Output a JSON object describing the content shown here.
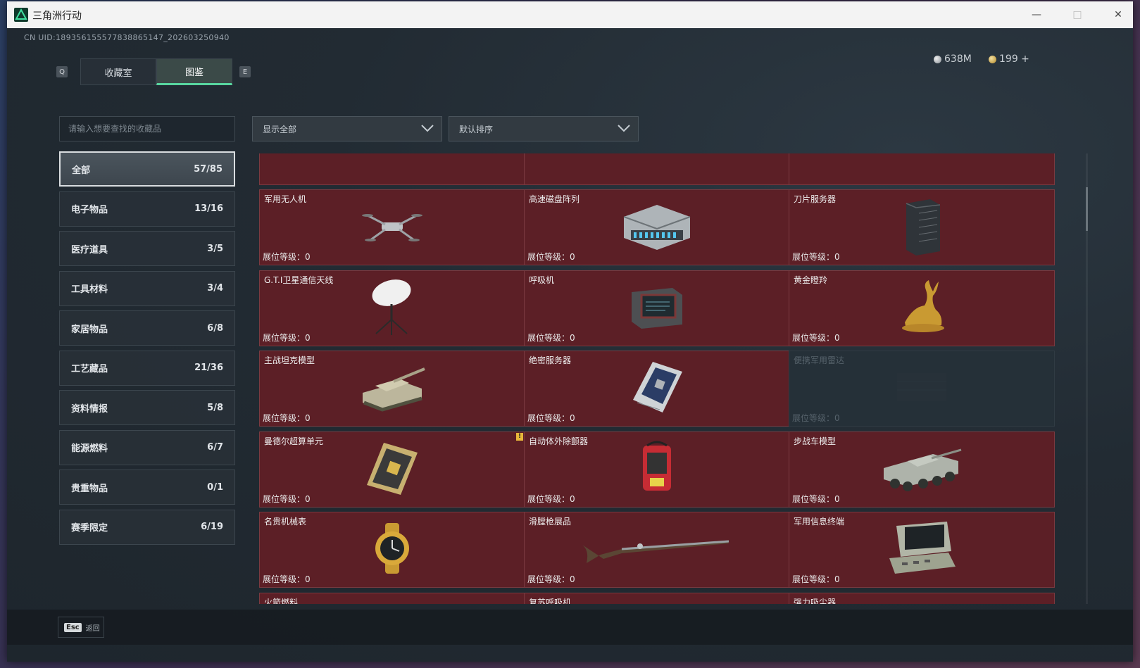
{
  "window": {
    "title": "三角洲行动",
    "minimize": "—",
    "maximize": "□",
    "close": "✕"
  },
  "header": {
    "uid": "CN UID:189356155577838865147_202603250940",
    "left_key": "Q",
    "right_key": "E",
    "tabs": [
      {
        "label": "收藏室",
        "active": false
      },
      {
        "label": "图鉴",
        "active": true
      }
    ],
    "currency": [
      {
        "icon": "silver-coin-icon",
        "value": "638M"
      },
      {
        "icon": "gold-coin-icon",
        "value": "199 +"
      }
    ]
  },
  "search": {
    "placeholder": "请输入想要查找的收藏品"
  },
  "filters": {
    "show": "显示全部",
    "sort": "默认排序"
  },
  "categories": [
    {
      "label": "全部",
      "count": "57/85",
      "active": true
    },
    {
      "label": "电子物品",
      "count": "13/16"
    },
    {
      "label": "医疗道具",
      "count": "3/5"
    },
    {
      "label": "工具材料",
      "count": "3/4"
    },
    {
      "label": "家居物品",
      "count": "6/8"
    },
    {
      "label": "工艺藏品",
      "count": "21/36"
    },
    {
      "label": "资料情报",
      "count": "5/8"
    },
    {
      "label": "能源燃料",
      "count": "6/7"
    },
    {
      "label": "贵重物品",
      "count": "0/1"
    },
    {
      "label": "赛季限定",
      "count": "6/19"
    }
  ],
  "items": [
    {
      "name": "军用无人机",
      "level": "展位等级：0",
      "icon": "drone-icon",
      "locked": false
    },
    {
      "name": "高速磁盘阵列",
      "level": "展位等级：0",
      "icon": "disk-array-icon",
      "locked": false
    },
    {
      "name": "刀片服务器",
      "level": "展位等级：0",
      "icon": "blade-server-icon",
      "locked": false
    },
    {
      "name": "G.T.I卫星通信天线",
      "level": "展位等级：0",
      "icon": "satellite-dish-icon",
      "locked": false
    },
    {
      "name": "呼吸机",
      "level": "展位等级：0",
      "icon": "ventilator-icon",
      "locked": false
    },
    {
      "name": "黄金瞪羚",
      "level": "展位等级：0",
      "icon": "gold-gazelle-icon",
      "locked": false
    },
    {
      "name": "主战坦克模型",
      "level": "展位等级：0",
      "icon": "tank-model-icon",
      "locked": false
    },
    {
      "name": "绝密服务器",
      "level": "展位等级：0",
      "icon": "secret-server-icon",
      "locked": false
    },
    {
      "name": "便携军用雷达",
      "level": "展位等级：0",
      "icon": "portable-radar-icon",
      "locked": true
    },
    {
      "name": "曼德尔超算单元",
      "level": "展位等级：0",
      "icon": "supercomputer-unit-icon",
      "locked": false,
      "badge": "!"
    },
    {
      "name": "自动体外除颤器",
      "level": "展位等级：0",
      "icon": "defibrillator-icon",
      "locked": false
    },
    {
      "name": "步战车模型",
      "level": "展位等级：0",
      "icon": "ifv-model-icon",
      "locked": false
    },
    {
      "name": "名贵机械表",
      "level": "展位等级：0",
      "icon": "watch-icon",
      "locked": false
    },
    {
      "name": "滑膛枪展品",
      "level": "展位等级：0",
      "icon": "musket-icon",
      "locked": false
    },
    {
      "name": "军用信息终端",
      "level": "展位等级：0",
      "icon": "military-terminal-icon",
      "locked": false
    },
    {
      "name": "火箭燃料",
      "level": "",
      "icon": "rocket-fuel-icon",
      "locked": false
    },
    {
      "name": "复苏呼吸机",
      "level": "",
      "icon": "resuscitator-icon",
      "locked": false
    },
    {
      "name": "强力吸尘器",
      "level": "",
      "icon": "vacuum-icon",
      "locked": false
    }
  ],
  "footer": {
    "esc_key": "Esc",
    "esc_label": "返回"
  },
  "colors": {
    "card_bg": "#5c1f26",
    "locked_bg": "#253038",
    "accent": "#58d6a0"
  }
}
